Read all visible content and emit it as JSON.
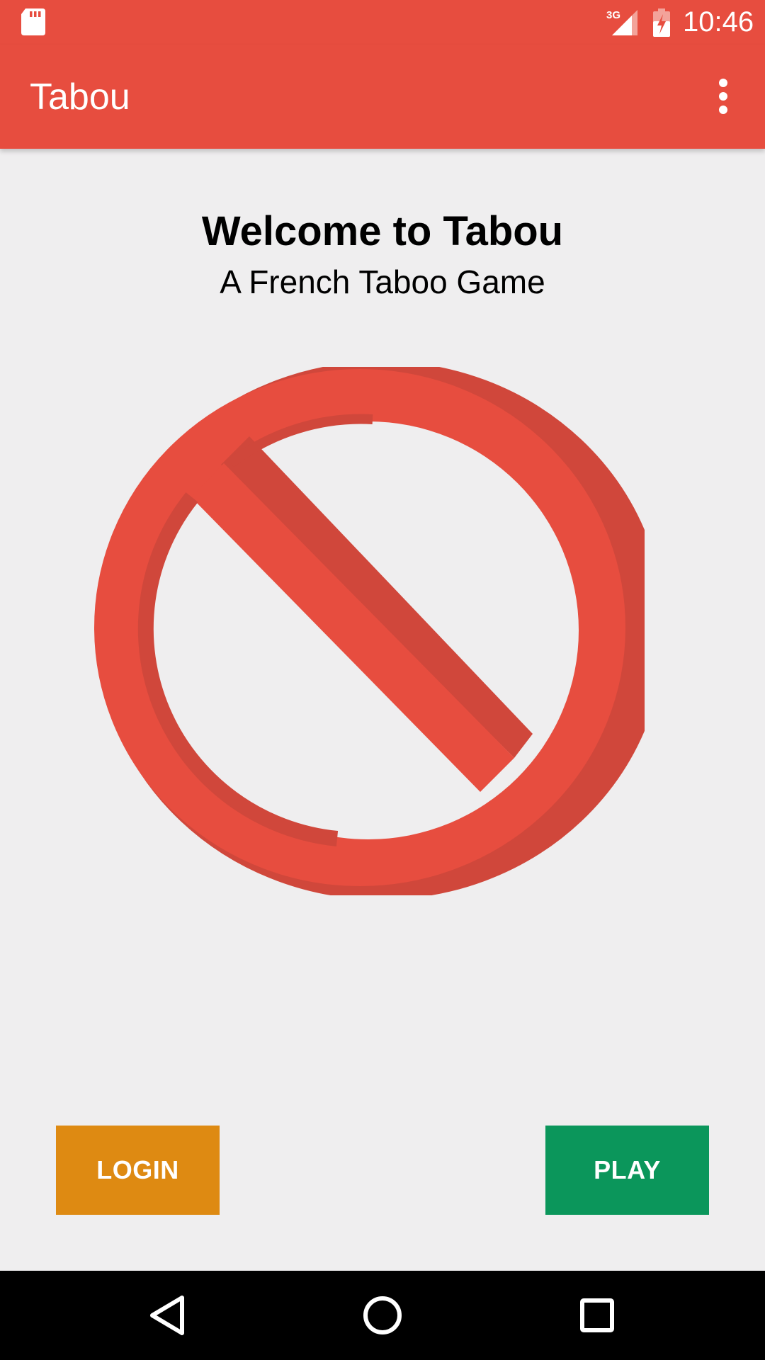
{
  "status_bar": {
    "time": "10:46",
    "network": "3G",
    "icons": [
      "sd-card-icon",
      "signal-icon",
      "battery-charging-icon"
    ]
  },
  "app_bar": {
    "title": "Tabou",
    "overflow_icon": "more-vert-icon"
  },
  "main": {
    "welcome_title": "Welcome to Tabou",
    "welcome_subtitle": "A French Taboo Game",
    "logo_icon": "prohibition-sign-icon"
  },
  "buttons": {
    "login_label": "LOGIN",
    "play_label": "PLAY"
  },
  "nav_bar": {
    "icons": [
      "back-icon",
      "home-icon",
      "recents-icon"
    ]
  },
  "colors": {
    "primary": "#e74d3f",
    "background": "#efeeef",
    "login_button": "#de8a12",
    "play_button": "#0b965b",
    "nav_bar": "#000000"
  }
}
